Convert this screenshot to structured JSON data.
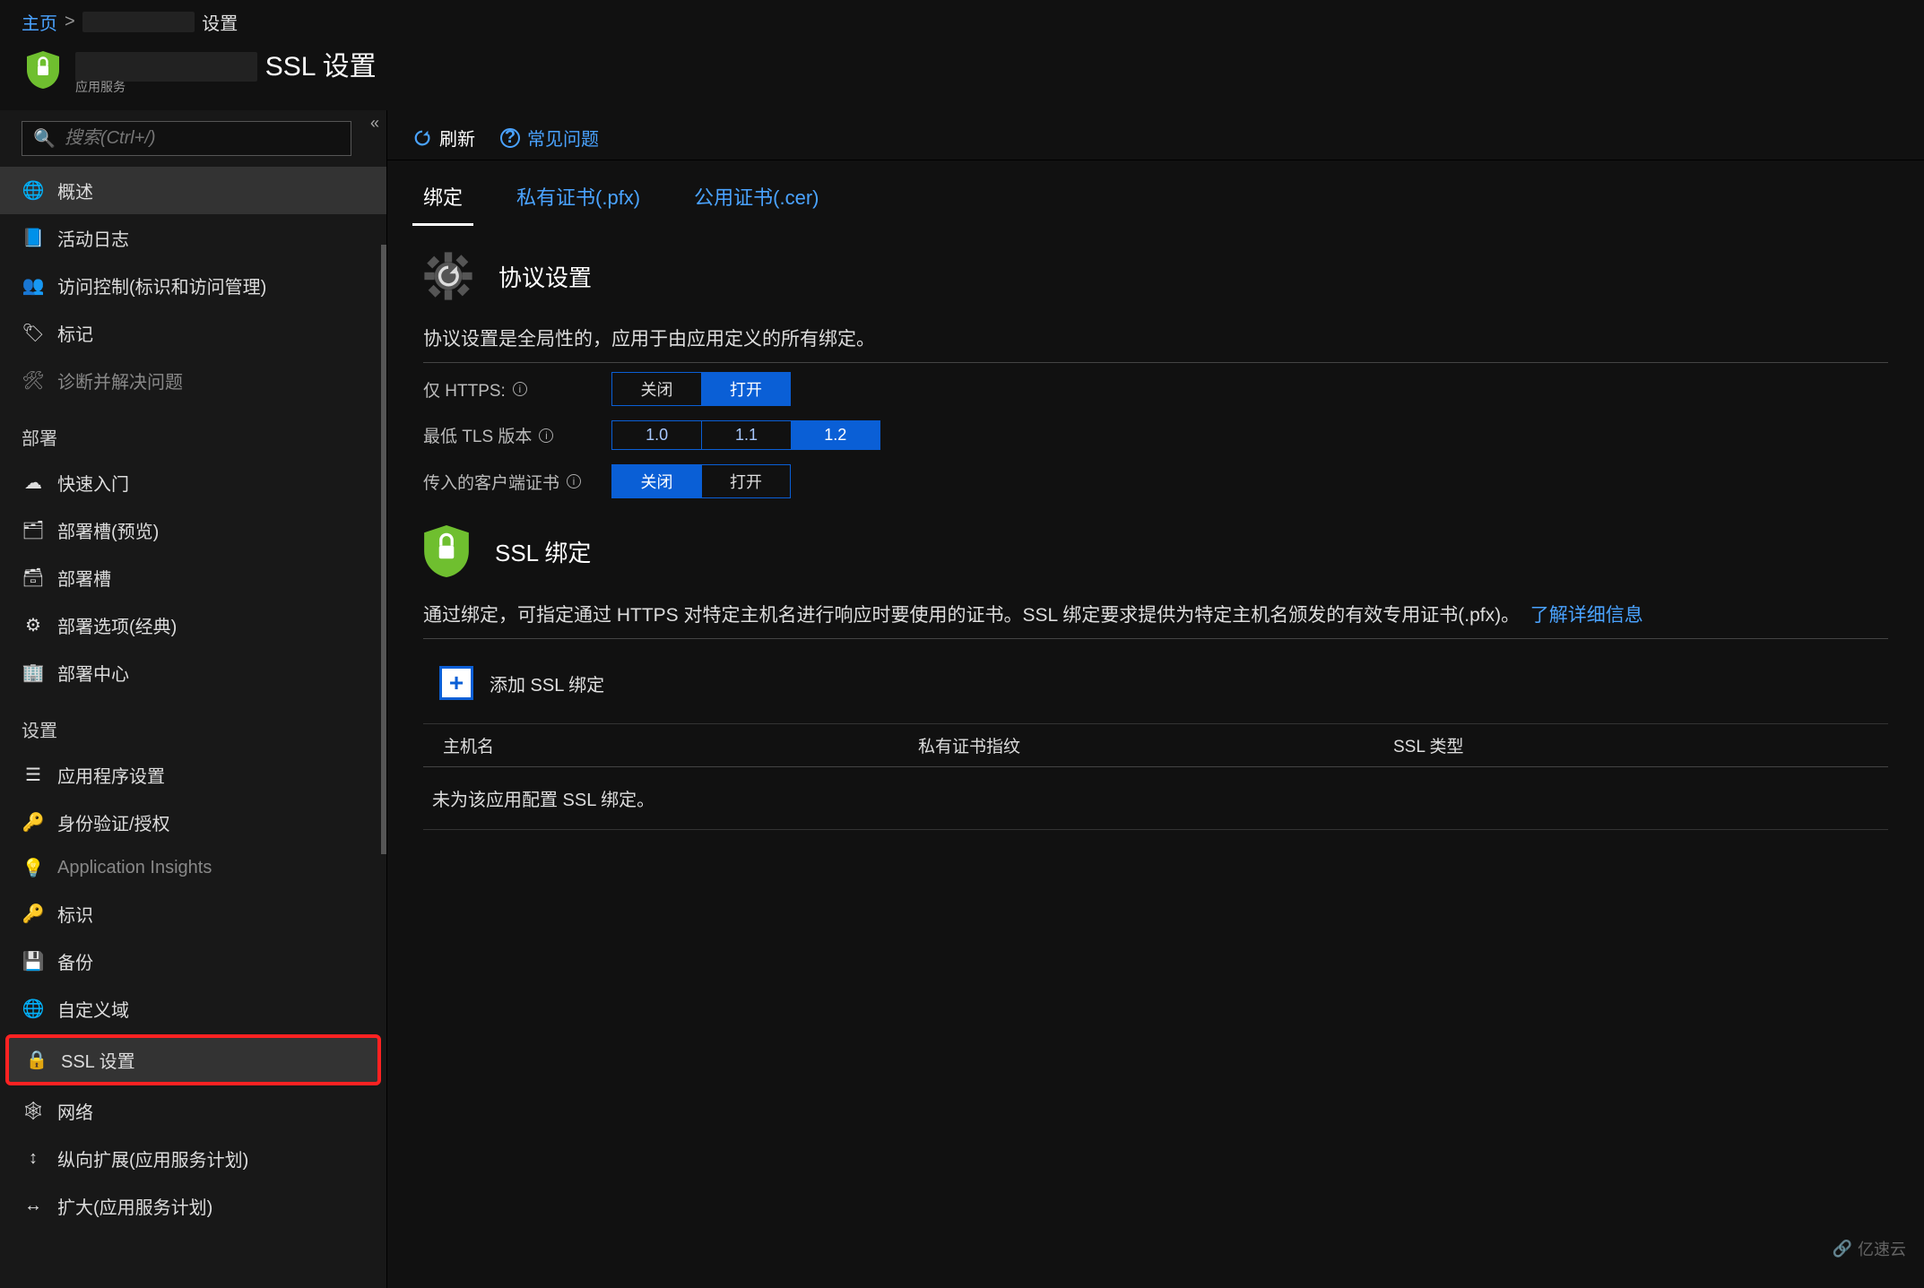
{
  "breadcrumb": {
    "home": "主页",
    "current": "设置"
  },
  "page": {
    "title_suffix": "SSL 设置",
    "subtitle": "应用服务"
  },
  "sidebar": {
    "search_placeholder": "搜索(Ctrl+/)",
    "items_top": [
      {
        "icon": "globe",
        "label": "概述",
        "active": true
      },
      {
        "icon": "log",
        "label": "活动日志"
      },
      {
        "icon": "iam",
        "label": "访问控制(标识和访问管理)"
      },
      {
        "icon": "tag",
        "label": "标记"
      },
      {
        "icon": "wrench",
        "label": "诊断并解决问题",
        "dim": true
      }
    ],
    "group_deploy": "部署",
    "items_deploy": [
      {
        "icon": "cloud",
        "label": "快速入门"
      },
      {
        "icon": "slots",
        "label": "部署槽(预览)"
      },
      {
        "icon": "slots2",
        "label": "部署槽"
      },
      {
        "icon": "gear",
        "label": "部署选项(经典)"
      },
      {
        "icon": "center",
        "label": "部署中心"
      }
    ],
    "group_settings": "设置",
    "items_settings": [
      {
        "icon": "appset",
        "label": "应用程序设置"
      },
      {
        "icon": "key",
        "label": "身份验证/授权"
      },
      {
        "icon": "bulb",
        "label": "Application Insights",
        "dim": true
      },
      {
        "icon": "key2",
        "label": "标识"
      },
      {
        "icon": "backup",
        "label": "备份"
      },
      {
        "icon": "domain",
        "label": "自定义域"
      },
      {
        "icon": "ssl",
        "label": "SSL 设置",
        "selected": true
      },
      {
        "icon": "net",
        "label": "网络"
      },
      {
        "icon": "scaleup",
        "label": "纵向扩展(应用服务计划)"
      },
      {
        "icon": "scaleout",
        "label": "扩大(应用服务计划)"
      }
    ]
  },
  "toolbar": {
    "refresh": "刷新",
    "faq": "常见问题"
  },
  "tabs": [
    {
      "label": "绑定",
      "active": true
    },
    {
      "label": "私有证书(.pfx)"
    },
    {
      "label": "公用证书(.cer)"
    }
  ],
  "protocol_section": {
    "title": "协议设置",
    "desc": "协议设置是全局性的，应用于由应用定义的所有绑定。",
    "rows": {
      "https_only": {
        "label": "仅 HTTPS:",
        "off": "关闭",
        "on": "打开",
        "value": "on"
      },
      "min_tls": {
        "label": "最低 TLS 版本",
        "opts": [
          "1.0",
          "1.1",
          "1.2"
        ],
        "value": "1.2"
      },
      "client_cert": {
        "label": "传入的客户端证书",
        "off": "关闭",
        "on": "打开",
        "value": "off"
      }
    }
  },
  "ssl_section": {
    "title": "SSL 绑定",
    "desc": "通过绑定，可指定通过 HTTPS 对特定主机名进行响应时要使用的证书。SSL 绑定要求提供为特定主机名颁发的有效专用证书(.pfx)。",
    "learn_more": "了解详细信息",
    "add_label": "添加 SSL 绑定",
    "columns": {
      "host": "主机名",
      "thumbprint": "私有证书指纹",
      "ssl_type": "SSL 类型"
    },
    "empty": "未为该应用配置 SSL 绑定。"
  },
  "watermark": "亿速云"
}
